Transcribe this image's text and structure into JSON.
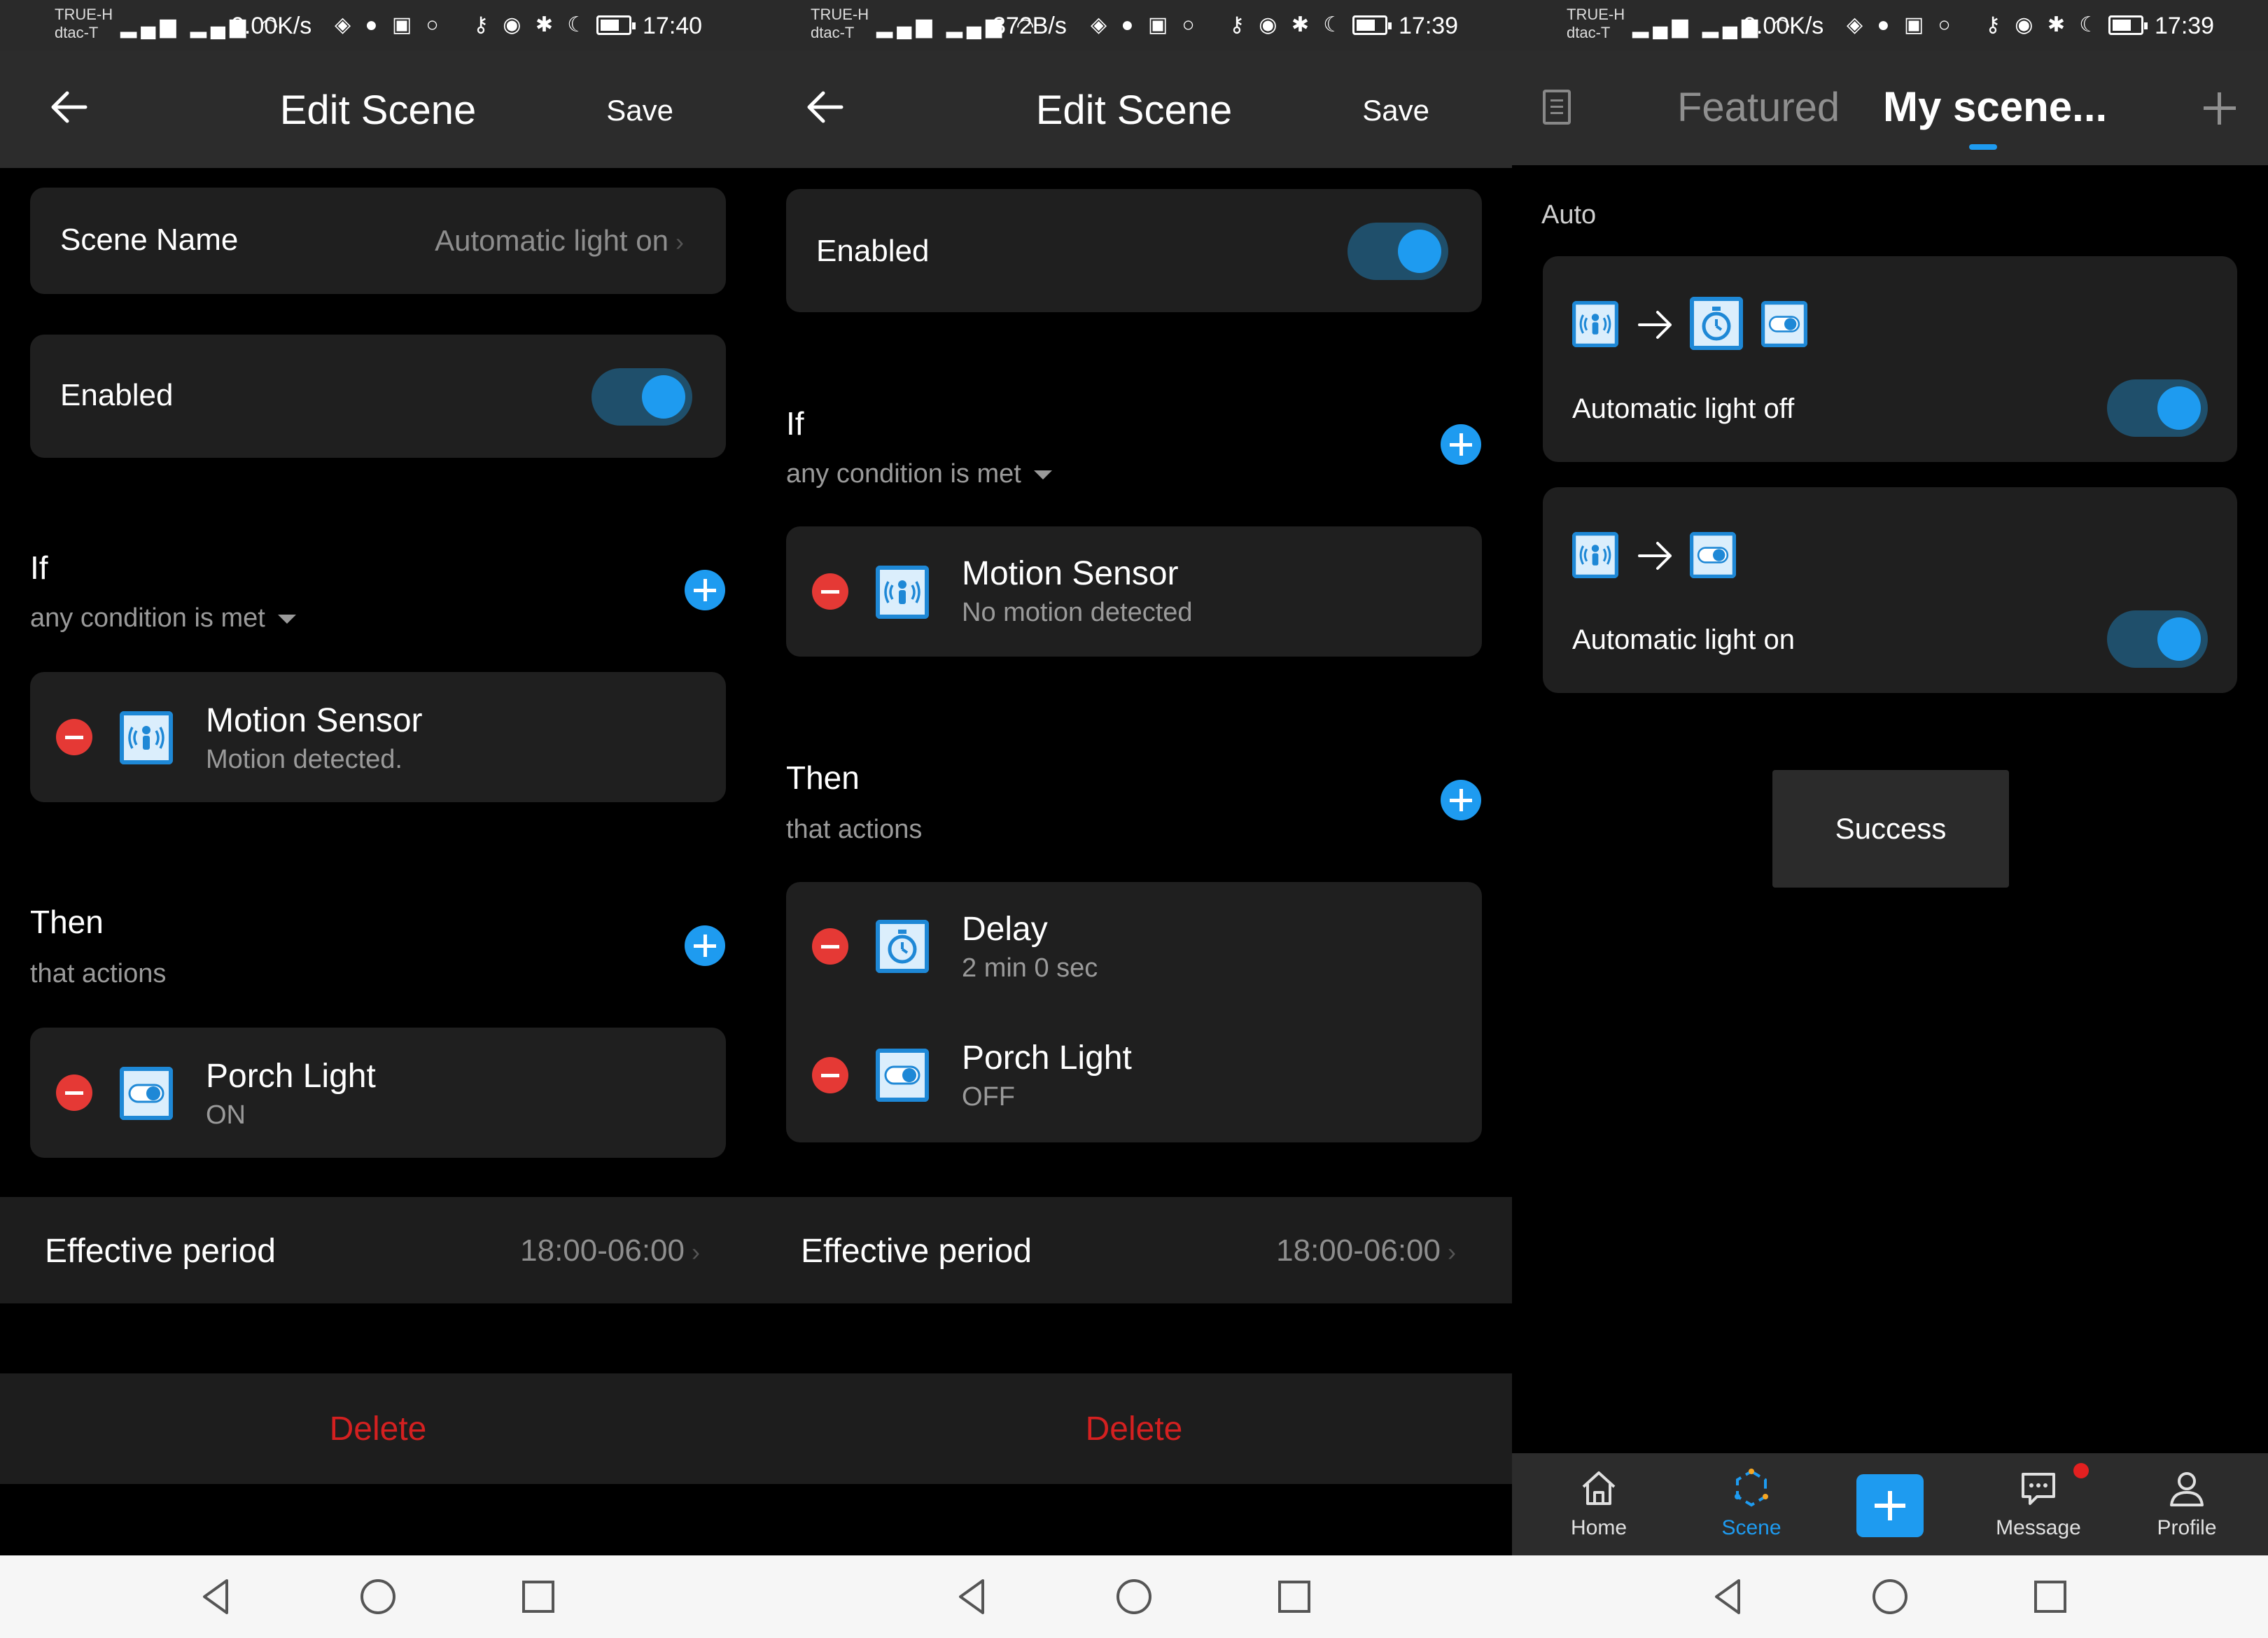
{
  "panels": [
    {
      "status": {
        "carrier1": "TRUE-H",
        "carrier2": "dtac-T",
        "speed": "0.00K/s",
        "time": "17:40"
      },
      "header": {
        "title": "Edit Scene",
        "save_label": "Save"
      },
      "scene_name": {
        "label": "Scene Name",
        "value": "Automatic light on"
      },
      "enabled": {
        "label": "Enabled",
        "on": true
      },
      "if": {
        "title": "If",
        "condition": "any condition is met",
        "items": [
          {
            "title": "Motion Sensor",
            "subtitle": "Motion detected.",
            "icon": "motion-sensor-icon"
          }
        ]
      },
      "then": {
        "title": "Then",
        "subtitle": "that actions",
        "items": [
          {
            "title": "Porch Light",
            "subtitle": "ON",
            "icon": "switch-icon"
          }
        ]
      },
      "effective_period": {
        "label": "Effective period",
        "value": "18:00-06:00"
      },
      "delete_label": "Delete"
    },
    {
      "status": {
        "carrier1": "TRUE-H",
        "carrier2": "dtac-T",
        "speed": "372B/s",
        "time": "17:39"
      },
      "header": {
        "title": "Edit Scene",
        "save_label": "Save"
      },
      "enabled": {
        "label": "Enabled",
        "on": true
      },
      "if": {
        "title": "If",
        "condition": "any condition is met",
        "items": [
          {
            "title": "Motion Sensor",
            "subtitle": "No motion detected",
            "icon": "motion-sensor-icon"
          }
        ]
      },
      "then": {
        "title": "Then",
        "subtitle": "that actions",
        "items": [
          {
            "title": "Delay",
            "subtitle": "2 min 0 sec",
            "icon": "timer-icon"
          },
          {
            "title": "Porch Light",
            "subtitle": "OFF",
            "icon": "switch-icon"
          }
        ]
      },
      "effective_period": {
        "label": "Effective period",
        "value": "18:00-06:00"
      },
      "delete_label": "Delete"
    },
    {
      "status": {
        "carrier1": "TRUE-H",
        "carrier2": "dtac-T",
        "speed": "0.00K/s",
        "time": "17:39"
      },
      "tabs": {
        "featured": "Featured",
        "my_scenes": "My scene..."
      },
      "section_label": "Auto",
      "scenes": [
        {
          "name": "Automatic light off",
          "enabled": true,
          "chain": [
            "motion-sensor-icon",
            "timer-icon",
            "switch-icon"
          ]
        },
        {
          "name": "Automatic light on",
          "enabled": true,
          "chain": [
            "motion-sensor-icon",
            "switch-icon"
          ]
        }
      ],
      "toast": "Success",
      "bottom_nav": [
        {
          "label": "Home",
          "icon": "home-icon"
        },
        {
          "label": "Scene",
          "icon": "scene-icon",
          "active": true
        },
        {
          "label": "",
          "icon": "add-icon"
        },
        {
          "label": "Message",
          "icon": "message-icon",
          "badge": true
        },
        {
          "label": "Profile",
          "icon": "profile-icon"
        }
      ]
    }
  ],
  "colors": {
    "accent": "#1e9bf0",
    "danger": "#e53935",
    "delete_text": "#d42020",
    "card": "#1f1f1f",
    "header": "#2c2c2c"
  }
}
